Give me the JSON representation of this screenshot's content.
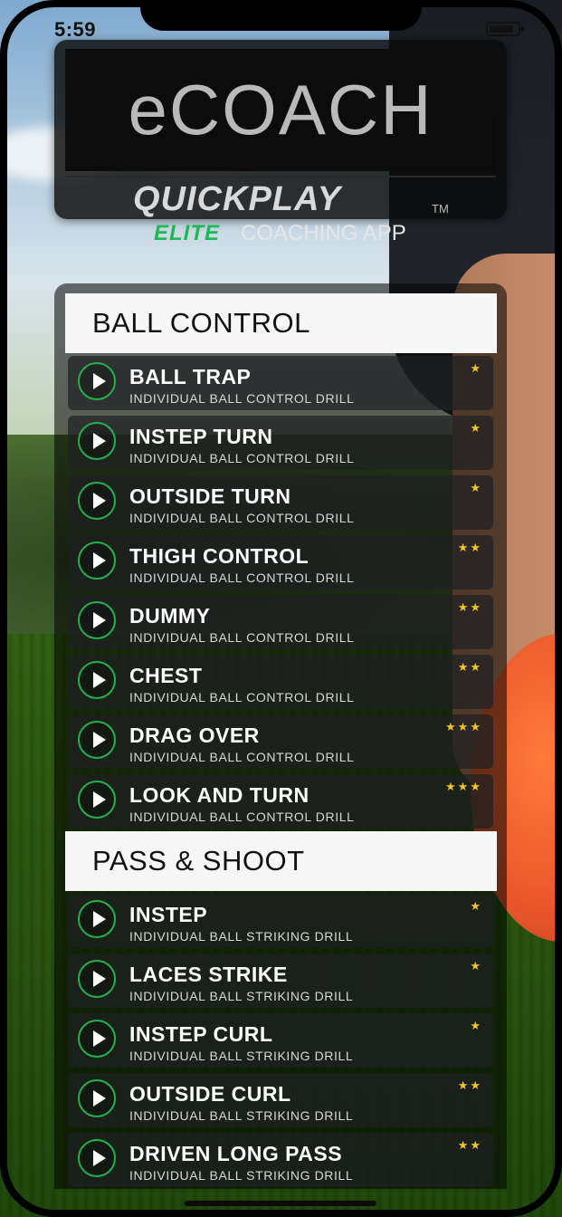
{
  "status_bar": {
    "time": "5:59"
  },
  "header": {
    "app_title": "eCOACH",
    "brand_main": "QUICKPLAY",
    "brand_tm": "TM",
    "brand_elite": "ELITE",
    "brand_sub": "COACHING APP"
  },
  "sections": [
    {
      "title": "BALL CONTROL",
      "items": [
        {
          "title": "BALL TRAP",
          "subtitle": "INDIVIDUAL BALL CONTROL DRILL",
          "stars": 1
        },
        {
          "title": "INSTEP TURN",
          "subtitle": "INDIVIDUAL BALL CONTROL DRILL",
          "stars": 1
        },
        {
          "title": "OUTSIDE TURN",
          "subtitle": "INDIVIDUAL BALL CONTROL DRILL",
          "stars": 1
        },
        {
          "title": "THIGH CONTROL",
          "subtitle": "INDIVIDUAL BALL CONTROL DRILL",
          "stars": 2
        },
        {
          "title": "DUMMY",
          "subtitle": "INDIVIDUAL BALL CONTROL DRILL",
          "stars": 2
        },
        {
          "title": "CHEST",
          "subtitle": "INDIVIDUAL BALL CONTROL DRILL",
          "stars": 2
        },
        {
          "title": "DRAG OVER",
          "subtitle": "INDIVIDUAL BALL CONTROL DRILL",
          "stars": 3
        },
        {
          "title": "LOOK AND TURN",
          "subtitle": "INDIVIDUAL BALL CONTROL DRILL",
          "stars": 3
        }
      ]
    },
    {
      "title": "PASS & SHOOT",
      "items": [
        {
          "title": "INSTEP",
          "subtitle": "INDIVIDUAL BALL STRIKING DRILL",
          "stars": 1
        },
        {
          "title": "LACES STRIKE",
          "subtitle": "INDIVIDUAL BALL STRIKING DRILL",
          "stars": 1
        },
        {
          "title": "INSTEP CURL",
          "subtitle": "INDIVIDUAL BALL STRIKING DRILL",
          "stars": 1
        },
        {
          "title": "OUTSIDE CURL",
          "subtitle": "INDIVIDUAL BALL STRIKING DRILL",
          "stars": 2
        },
        {
          "title": "DRIVEN LONG PASS",
          "subtitle": "INDIVIDUAL BALL STRIKING DRILL",
          "stars": 2
        }
      ]
    }
  ],
  "colors": {
    "accent_green": "#22b14c",
    "star": "#f5c518"
  },
  "icons": {
    "play": "play-circle-icon",
    "star": "star-icon"
  }
}
